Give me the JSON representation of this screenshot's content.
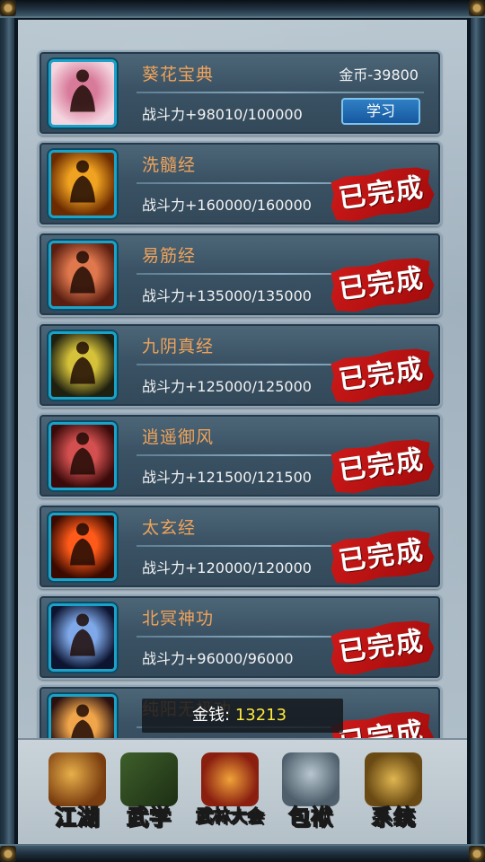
{
  "skills": [
    {
      "name": "葵花宝典",
      "stat": "战斗力+98010/100000",
      "cost": "金币-39800",
      "action": "学习",
      "status": "learn",
      "icon": "portrait-woman-icon",
      "art": [
        "#d87a9a",
        "#f4d6e0"
      ]
    },
    {
      "name": "洗髓经",
      "stat": "战斗力+160000/160000",
      "stamp": "已完成",
      "status": "done",
      "icon": "golden-buddha-icon",
      "art": [
        "#f0a321",
        "#6b2a00"
      ]
    },
    {
      "name": "易筋经",
      "stat": "战斗力+135000/135000",
      "stamp": "已完成",
      "status": "done",
      "icon": "meditating-monk-icon",
      "art": [
        "#e0784e",
        "#5a1e10"
      ]
    },
    {
      "name": "九阴真经",
      "stat": "战斗力+125000/125000",
      "stamp": "已完成",
      "status": "done",
      "icon": "kungfu-fighter-icon",
      "art": [
        "#d6c23a",
        "#1e2010"
      ]
    },
    {
      "name": "逍遥御风",
      "stat": "战斗力+121500/121500",
      "stamp": "已完成",
      "status": "done",
      "icon": "wind-figure-icon",
      "art": [
        "#d45050",
        "#3a0a0a"
      ]
    },
    {
      "name": "太玄经",
      "stat": "战斗力+120000/120000",
      "stamp": "已完成",
      "status": "done",
      "icon": "crossed-swords-fighter-icon",
      "art": [
        "#ff5a1a",
        "#3a0a00"
      ]
    },
    {
      "name": "北冥神功",
      "stat": "战斗力+96000/96000",
      "stamp": "已完成",
      "status": "done",
      "icon": "dark-power-fighter-icon",
      "art": [
        "#7ea8e8",
        "#0c1430"
      ]
    },
    {
      "name": "纯阳无极功",
      "stat": "",
      "stamp": "已完成",
      "status": "done",
      "icon": "glowing-monk-icon",
      "art": [
        "#f0a54a",
        "#2a1010"
      ]
    }
  ],
  "money": {
    "label": "金钱:",
    "value": "13213"
  },
  "nav": [
    {
      "label": "江湖",
      "icon": "gourd-umbrella-icon",
      "active": false
    },
    {
      "label": "武学",
      "icon": "martial-book-icon",
      "active": true
    },
    {
      "label": "武林大会",
      "icon": "war-drum-icon",
      "active": false
    },
    {
      "label": "包袱",
      "icon": "cloth-bag-icon",
      "active": false
    },
    {
      "label": "系统",
      "icon": "gear-icon",
      "active": false
    }
  ]
}
